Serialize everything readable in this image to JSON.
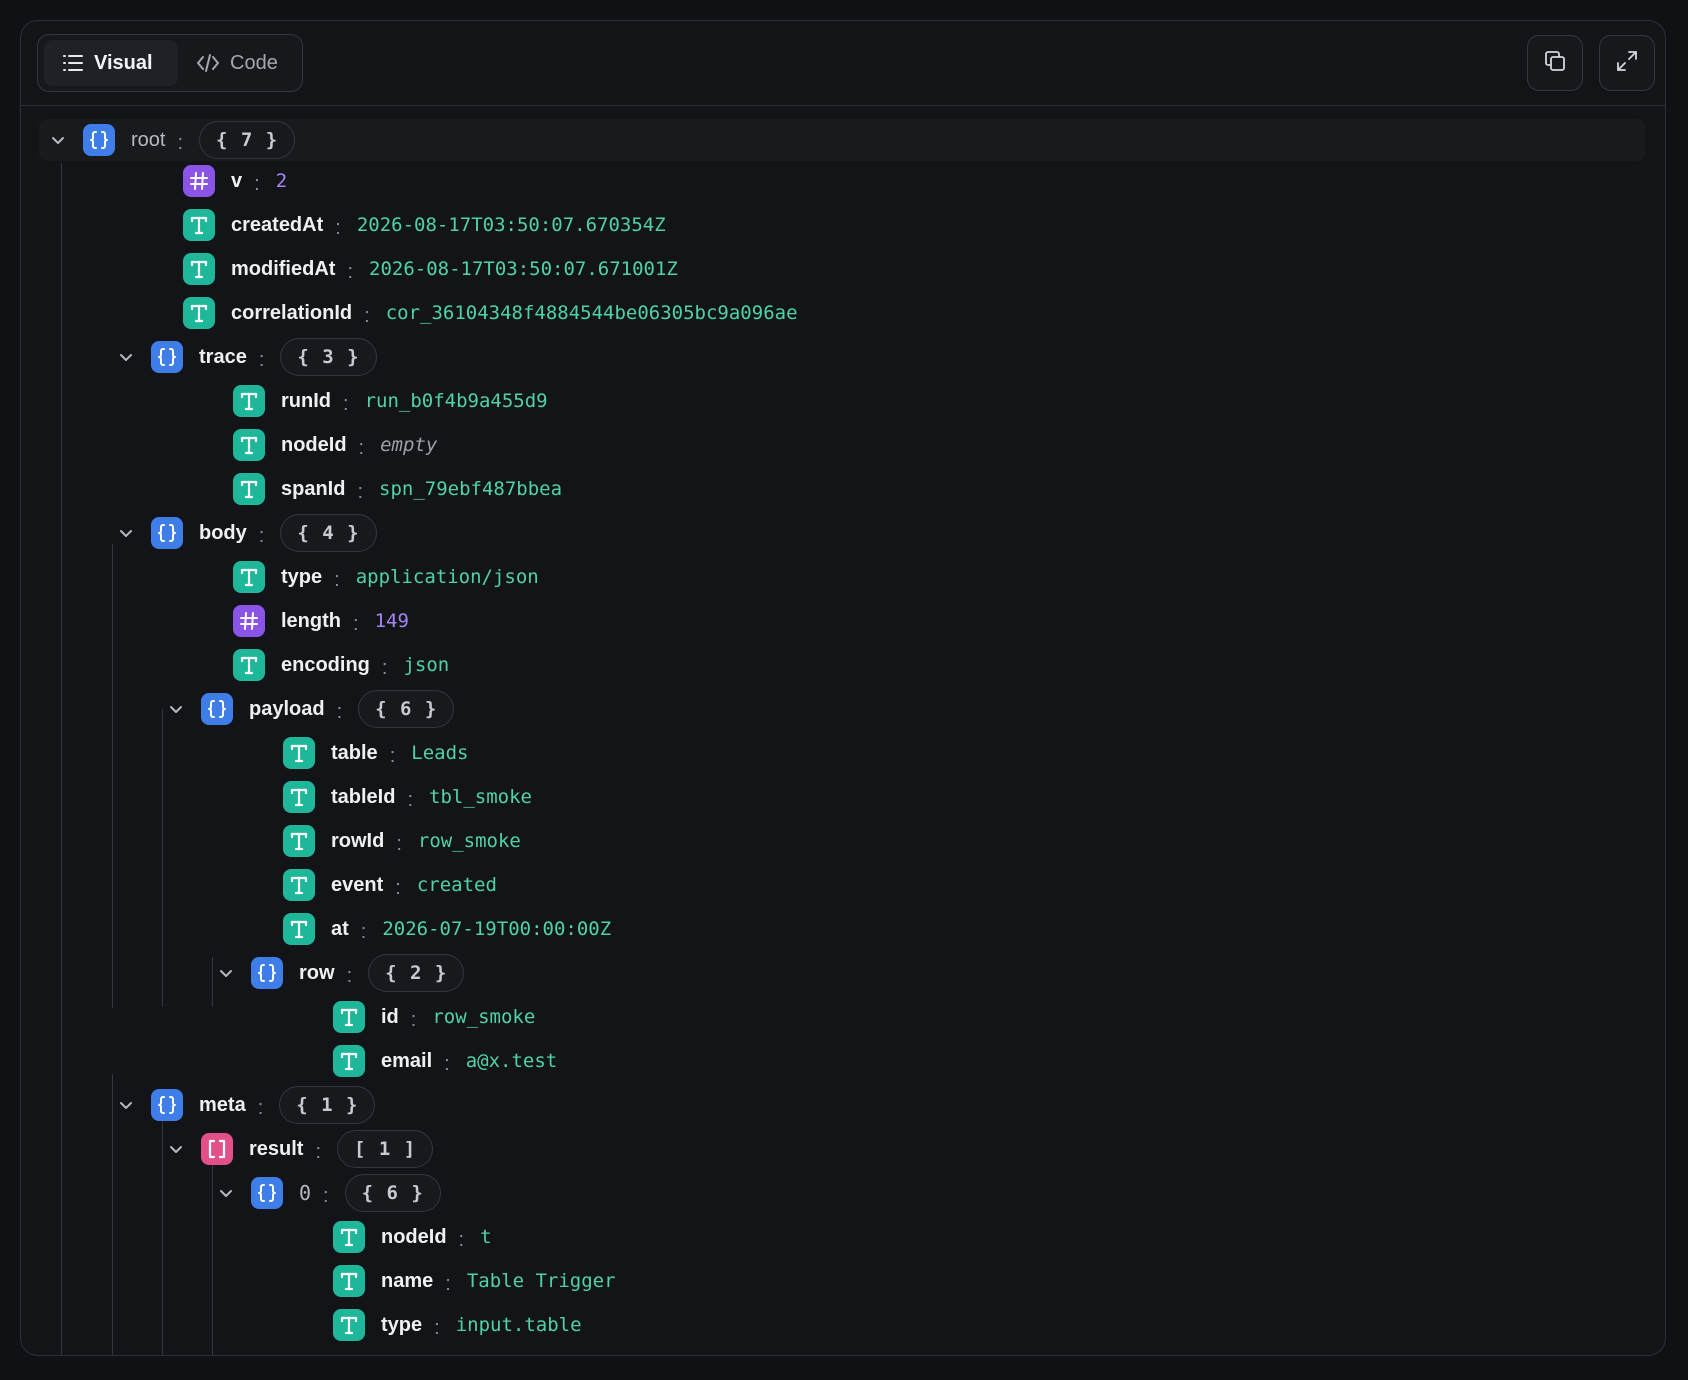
{
  "toolbar": {
    "visual_label": "Visual",
    "code_label": "Code",
    "copy_icon": "copy-icon",
    "expand_icon": "expand-icon"
  },
  "tree": {
    "root": {
      "key": "root",
      "count": "{ 7 }"
    },
    "v": {
      "key": "v",
      "value": "2"
    },
    "createdAt": {
      "key": "createdAt",
      "value": "2026-08-17T03:50:07.670354Z"
    },
    "modifiedAt": {
      "key": "modifiedAt",
      "value": "2026-08-17T03:50:07.671001Z"
    },
    "correlationId": {
      "key": "correlationId",
      "value": "cor_36104348f4884544be06305bc9a096ae"
    },
    "trace": {
      "key": "trace",
      "count": "{ 3 }",
      "runId": {
        "key": "runId",
        "value": "run_b0f4b9a455d9"
      },
      "nodeId": {
        "key": "nodeId",
        "value": "empty"
      },
      "spanId": {
        "key": "spanId",
        "value": "spn_79ebf487bbea"
      }
    },
    "body": {
      "key": "body",
      "count": "{ 4 }",
      "type": {
        "key": "type",
        "value": "application/json"
      },
      "length": {
        "key": "length",
        "value": "149"
      },
      "encoding": {
        "key": "encoding",
        "value": "json"
      },
      "payload": {
        "key": "payload",
        "count": "{ 6 }",
        "table": {
          "key": "table",
          "value": "Leads"
        },
        "tableId": {
          "key": "tableId",
          "value": "tbl_smoke"
        },
        "rowId": {
          "key": "rowId",
          "value": "row_smoke"
        },
        "event": {
          "key": "event",
          "value": "created"
        },
        "at": {
          "key": "at",
          "value": "2026-07-19T00:00:00Z"
        },
        "row": {
          "key": "row",
          "count": "{ 2 }",
          "id": {
            "key": "id",
            "value": "row_smoke"
          },
          "email": {
            "key": "email",
            "value": "a@x.test"
          }
        }
      }
    },
    "meta": {
      "key": "meta",
      "count": "{ 1 }",
      "result": {
        "key": "result",
        "count": "[ 1 ]",
        "item0": {
          "key": "0",
          "count": "{ 6 }",
          "nodeId": {
            "key": "nodeId",
            "value": "t"
          },
          "name": {
            "key": "name",
            "value": "Table Trigger"
          },
          "type": {
            "key": "type",
            "value": "input.table"
          }
        }
      }
    }
  },
  "colors": {
    "object_badge": "#3f7de8",
    "string_badge": "#1fb79a",
    "number_badge": "#8a55e6",
    "array_badge": "#e2508a",
    "string_value": "#4fd3a6",
    "number_value": "#a585f2"
  }
}
